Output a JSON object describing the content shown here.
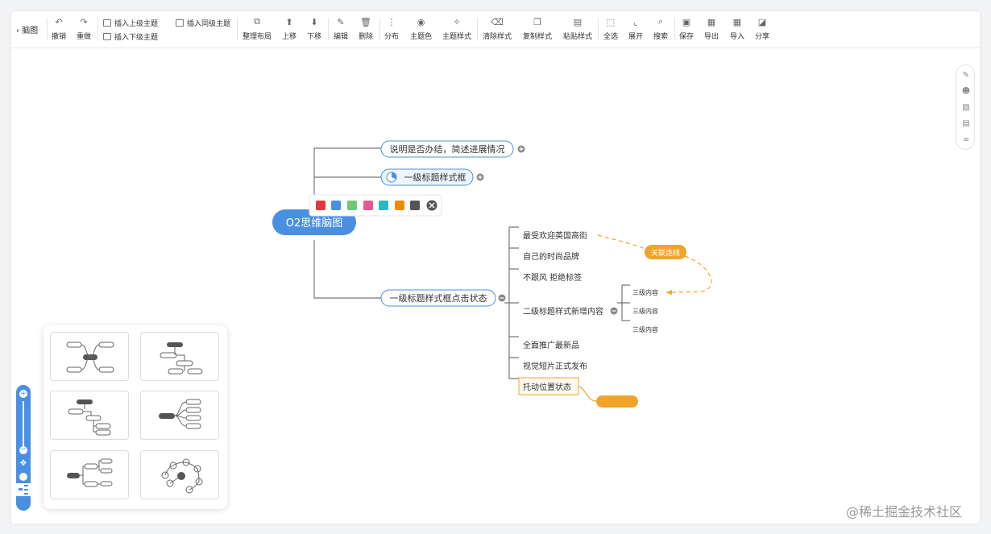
{
  "toolbar": {
    "back_label": "脑图",
    "items": [
      {
        "label": "撤销",
        "icon": "undo-icon"
      },
      {
        "label": "重做",
        "icon": "redo-icon"
      },
      {
        "label": "整理布局",
        "icon": "layout-icon"
      },
      {
        "label": "上移",
        "icon": "arrow-up-icon"
      },
      {
        "label": "下移",
        "icon": "arrow-down-icon"
      },
      {
        "label": "编辑",
        "icon": "edit-icon"
      },
      {
        "label": "删除",
        "icon": "trash-icon"
      },
      {
        "label": "分布",
        "icon": "distribute-icon"
      },
      {
        "label": "主题色",
        "icon": "palette-icon"
      },
      {
        "label": "主题样式",
        "icon": "magic-wand-icon"
      },
      {
        "label": "清除样式",
        "icon": "eraser-icon"
      },
      {
        "label": "复制样式",
        "icon": "copy-icon"
      },
      {
        "label": "粘贴样式",
        "icon": "paint-roller-icon"
      },
      {
        "label": "全选",
        "icon": "select-all-icon"
      },
      {
        "label": "展开",
        "icon": "expand-icon"
      },
      {
        "label": "搜索",
        "icon": "search-icon"
      },
      {
        "label": "保存",
        "icon": "save-icon"
      },
      {
        "label": "导出",
        "icon": "export-icon"
      },
      {
        "label": "导入",
        "icon": "import-icon"
      },
      {
        "label": "分享",
        "icon": "share-icon"
      }
    ],
    "insert_parent": "插入上级主题",
    "insert_sibling": "插入同级主题",
    "insert_child": "插入下级主题"
  },
  "mindmap": {
    "root": "O2思维脑图",
    "topic1": "说明是否办结，简述进展情况",
    "topic2": "一级标题样式框",
    "topic3": "一级标题样式框点击状态",
    "sub_items": [
      "最受欢迎英国高街",
      "自己的时尚品牌",
      "不跟风 拒绝标签",
      "二级标题样式新增内容",
      "全面推广最新品",
      "视觉短片正式发布",
      "托动位置状态"
    ],
    "third_items": [
      "三级内容",
      "三级内容",
      "三级内容"
    ],
    "relation_label": "关联连线",
    "colors": [
      "#e0383e",
      "#4a90e2",
      "#6cc77a",
      "#e55a8e",
      "#2cb8c2",
      "#f08a00",
      "#555555"
    ],
    "accent": "#4a90e2",
    "relation_color": "#f0a52a"
  },
  "watermark": "@稀土掘金技术社区"
}
